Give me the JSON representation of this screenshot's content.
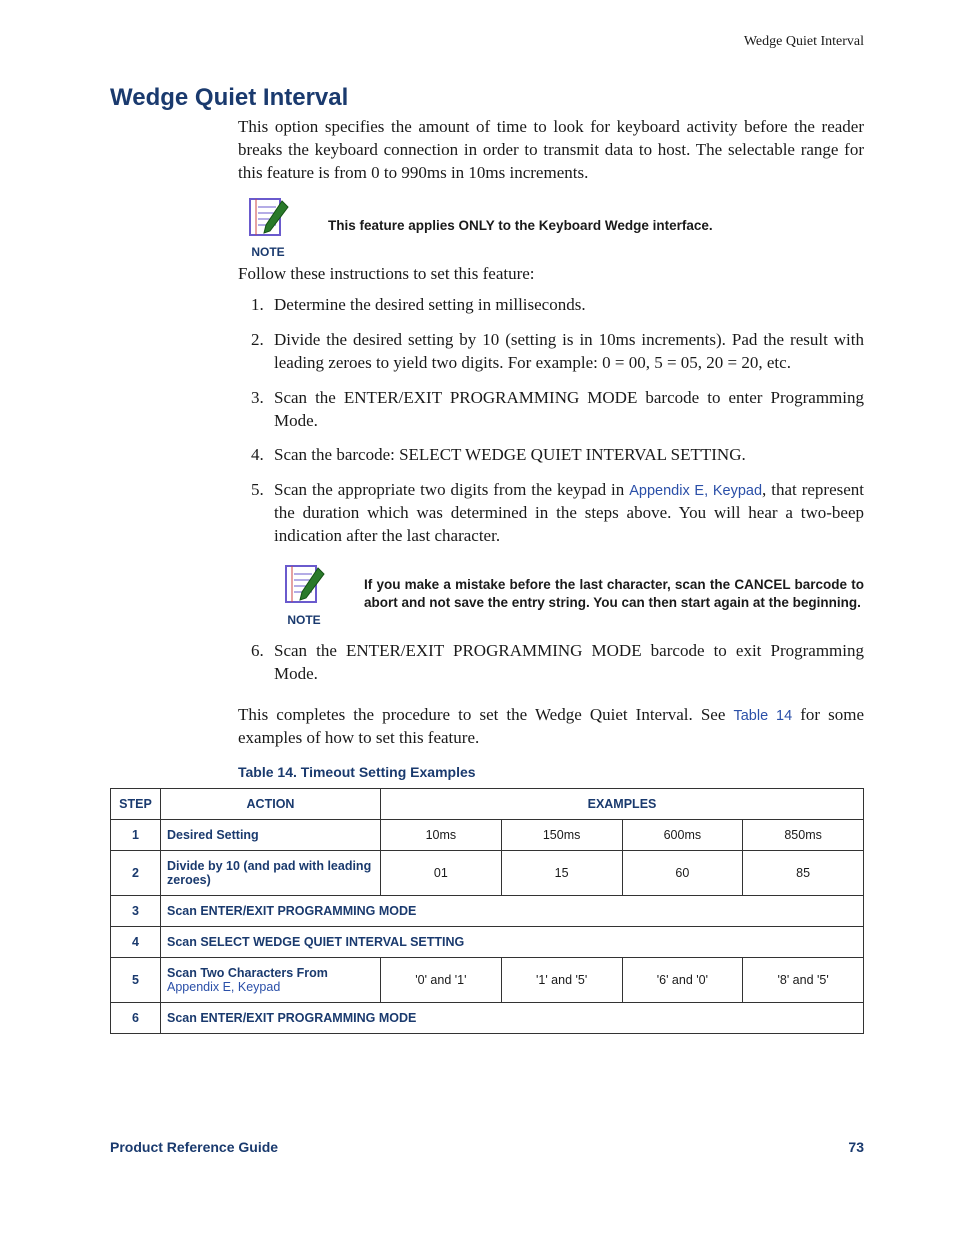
{
  "running_header": "Wedge Quiet Interval",
  "title": "Wedge Quiet Interval",
  "intro": "This option specifies the amount of time to look for keyboard activity before the reader breaks the keyboard connection in order to transmit data to host. The selectable range for this feature is from 0 to 990ms in 10ms increments.",
  "note1": {
    "label": "NOTE",
    "text": "This feature applies ONLY to the Keyboard Wedge interface."
  },
  "follow": "Follow these instructions to set this feature:",
  "steps": {
    "s1": "Determine the desired setting in milliseconds.",
    "s2": "Divide the desired setting by 10 (setting is in 10ms increments).  Pad the result with leading zeroes to yield two digits. For example: 0 = 00, 5 = 05, 20 = 20, etc.",
    "s3": "Scan the ENTER/EXIT PROGRAMMING MODE barcode to enter Programming Mode.",
    "s4": "Scan the barcode: SELECT WEDGE QUIET INTERVAL SETTING.",
    "s5a": "Scan the appropriate two digits from the keypad in ",
    "s5_link": "Appendix E, Keypad",
    "s5b": ", that represent the duration which was determined in the steps above. You will hear a two-beep indication after the last character.",
    "s6": "Scan the ENTER/EXIT PROGRAMMING MODE barcode to exit Programming Mode."
  },
  "note2": {
    "label": "NOTE",
    "text": "If you make a mistake before the last character, scan the CANCEL barcode to abort and not save the entry string. You can then start again at the beginning."
  },
  "closing_a": "This completes the procedure to set the Wedge Quiet Interval. See ",
  "closing_link": "Table 14",
  "closing_b": " for some examples of how to set this feature.",
  "table": {
    "title": "Table 14. Timeout Setting Examples",
    "headers": {
      "step": "STEP",
      "action": "ACTION",
      "examples": "EXAMPLES"
    },
    "rows": {
      "r1": {
        "step": "1",
        "action": "Desired Setting",
        "e": [
          "10ms",
          "150ms",
          "600ms",
          "850ms"
        ]
      },
      "r2": {
        "step": "2",
        "action": "Divide by 10 (and pad with leading zeroes)",
        "e": [
          "01",
          "15",
          "60",
          "85"
        ]
      },
      "r3": {
        "step": "3",
        "action": "Scan ENTER/EXIT PROGRAMMING MODE"
      },
      "r4": {
        "step": "4",
        "action": "Scan SELECT WEDGE QUIET INTERVAL SETTING"
      },
      "r5": {
        "step": "5",
        "action_a": "Scan Two Characters From ",
        "action_link": "Appendix E, Keypad",
        "e": [
          "'0' and '1'",
          "'1' and '5'",
          "'6' and '0'",
          "'8' and '5'"
        ]
      },
      "r6": {
        "step": "6",
        "action": "Scan ENTER/EXIT PROGRAMMING MODE"
      }
    }
  },
  "footer": {
    "left": "Product Reference Guide",
    "right": "73"
  }
}
